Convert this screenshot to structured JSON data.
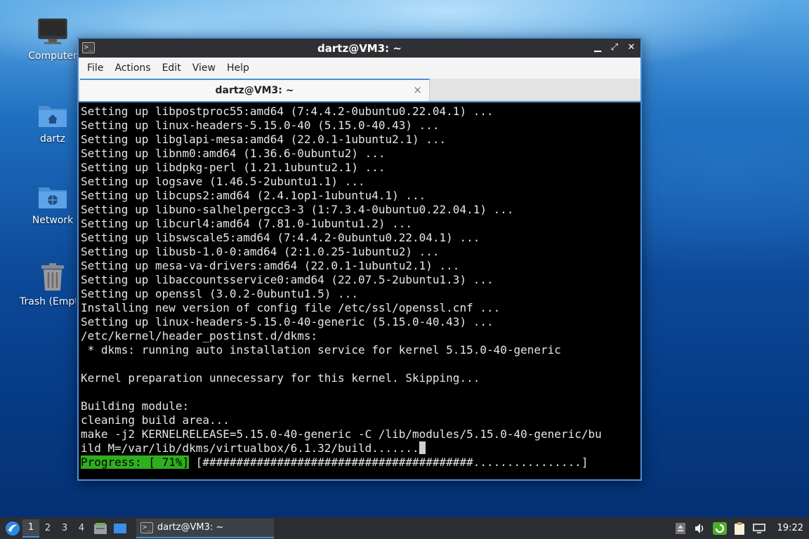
{
  "desktop": {
    "icons": [
      {
        "label": "Computer"
      },
      {
        "label": "dartz"
      },
      {
        "label": "Network"
      },
      {
        "label": "Trash (Empty)"
      }
    ]
  },
  "window": {
    "title": "dartz@VM3: ~",
    "menu": [
      "File",
      "Actions",
      "Edit",
      "View",
      "Help"
    ],
    "tab_label": "dartz@VM3: ~",
    "tab_close": "×",
    "controls": {
      "minimize": "▁",
      "maximize": "⤢",
      "close": "✕"
    }
  },
  "terminal": {
    "lines": [
      "Setting up libpostproc55:amd64 (7:4.4.2-0ubuntu0.22.04.1) ...",
      "Setting up linux-headers-5.15.0-40 (5.15.0-40.43) ...",
      "Setting up libglapi-mesa:amd64 (22.0.1-1ubuntu2.1) ...",
      "Setting up libnm0:amd64 (1.36.6-0ubuntu2) ...",
      "Setting up libdpkg-perl (1.21.1ubuntu2.1) ...",
      "Setting up logsave (1.46.5-2ubuntu1.1) ...",
      "Setting up libcups2:amd64 (2.4.1op1-1ubuntu4.1) ...",
      "Setting up libuno-salhelpergcc3-3 (1:7.3.4-0ubuntu0.22.04.1) ...",
      "Setting up libcurl4:amd64 (7.81.0-1ubuntu1.2) ...",
      "Setting up libswscale5:amd64 (7:4.4.2-0ubuntu0.22.04.1) ...",
      "Setting up libusb-1.0-0:amd64 (2:1.0.25-1ubuntu2) ...",
      "Setting up mesa-va-drivers:amd64 (22.0.1-1ubuntu2.1) ...",
      "Setting up libaccountsservice0:amd64 (22.07.5-2ubuntu1.3) ...",
      "Setting up openssl (3.0.2-0ubuntu1.5) ...",
      "Installing new version of config file /etc/ssl/openssl.cnf ...",
      "Setting up linux-headers-5.15.0-40-generic (5.15.0-40.43) ...",
      "/etc/kernel/header_postinst.d/dkms:",
      " * dkms: running auto installation service for kernel 5.15.0-40-generic",
      "",
      "Kernel preparation unnecessary for this kernel. Skipping...",
      "",
      "Building module:",
      "cleaning build area...",
      "make -j2 KERNELRELEASE=5.15.0-40-generic -C /lib/modules/5.15.0-40-generic/bu"
    ],
    "last_line": "ild M=/var/lib/dkms/virtualbox/6.1.32/build.......",
    "progress_label": "Progress: [ 71%]",
    "progress_bar": " [########################################................]"
  },
  "taskbar": {
    "workspaces": [
      "1",
      "2",
      "3",
      "4"
    ],
    "active_workspace": "1",
    "task_label": "dartz@VM3: ~",
    "clock": "19:22"
  }
}
